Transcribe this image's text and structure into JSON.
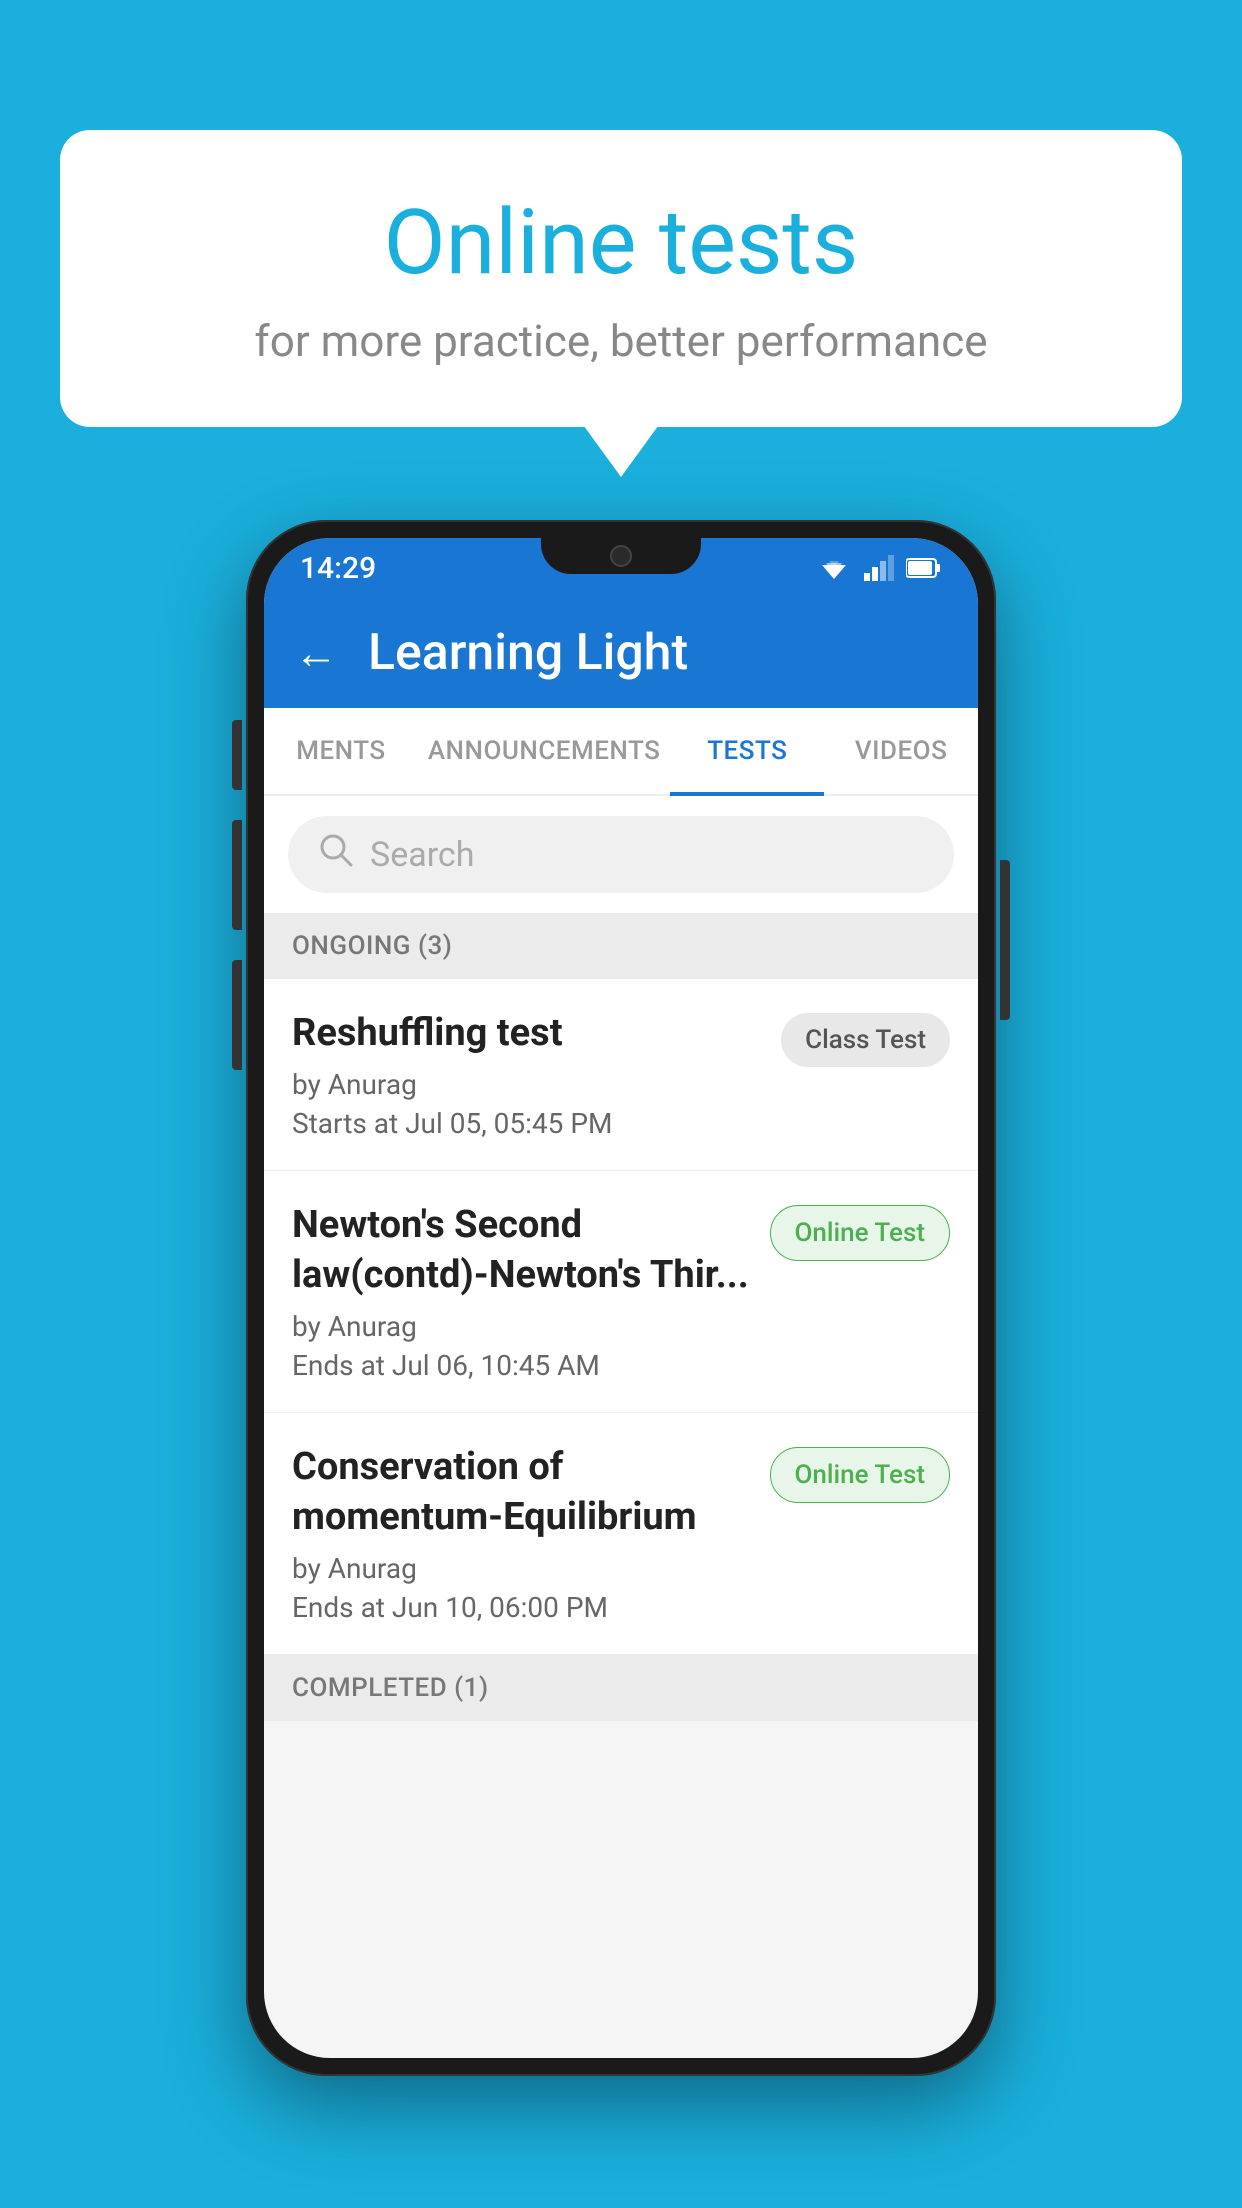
{
  "background_color": "#1AAFDC",
  "speech_bubble": {
    "title": "Online tests",
    "subtitle": "for more practice, better performance"
  },
  "phone": {
    "status_bar": {
      "time": "14:29",
      "icons": [
        "wifi",
        "signal",
        "battery"
      ]
    },
    "app_bar": {
      "title": "Learning Light",
      "back_label": "←"
    },
    "tabs": [
      {
        "label": "MENTS",
        "active": false
      },
      {
        "label": "ANNOUNCEMENTS",
        "active": false
      },
      {
        "label": "TESTS",
        "active": true
      },
      {
        "label": "VIDEOS",
        "active": false
      }
    ],
    "search": {
      "placeholder": "Search"
    },
    "ongoing_section": {
      "label": "ONGOING (3)"
    },
    "tests": [
      {
        "name": "Reshuffling test",
        "author": "by Anurag",
        "time_label": "Starts at",
        "time": "Jul 05, 05:45 PM",
        "badge": "Class Test",
        "badge_type": "class"
      },
      {
        "name": "Newton's Second law(contd)-Newton's Thir...",
        "author": "by Anurag",
        "time_label": "Ends at",
        "time": "Jul 06, 10:45 AM",
        "badge": "Online Test",
        "badge_type": "online"
      },
      {
        "name": "Conservation of momentum-Equilibrium",
        "author": "by Anurag",
        "time_label": "Ends at",
        "time": "Jun 10, 06:00 PM",
        "badge": "Online Test",
        "badge_type": "online"
      }
    ],
    "completed_section": {
      "label": "COMPLETED (1)"
    }
  }
}
